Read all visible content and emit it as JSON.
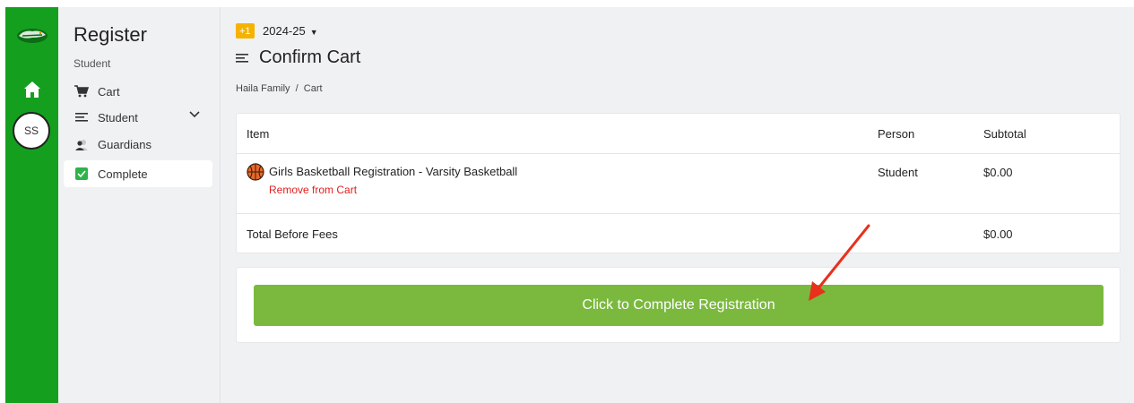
{
  "rail": {
    "logo_icon": "gator-logo-icon",
    "home_icon": "home-icon",
    "avatar_initials": "SS",
    "accent": "#14a01e"
  },
  "sidebar": {
    "title": "Register",
    "subtitle": "Student",
    "items": [
      {
        "label": "Cart",
        "icon": "cart-icon"
      },
      {
        "label": "Student",
        "icon": "menu-icon",
        "expanded": true
      },
      {
        "label": "Guardians",
        "icon": "guardians-icon"
      },
      {
        "label": "Complete",
        "icon": "checkbox-checked-icon",
        "active": true
      }
    ]
  },
  "header": {
    "year_badge": "+1",
    "year": "2024-25",
    "title": "Confirm Cart",
    "breadcrumb": "Haila Family  /  Cart"
  },
  "cart": {
    "columns": {
      "item": "Item",
      "person": "Person",
      "subtotal": "Subtotal"
    },
    "rows": [
      {
        "icon": "basketball-icon",
        "item": "Girls Basketball Registration - Varsity Basketball",
        "remove_label": "Remove from Cart",
        "person": "Student",
        "subtotal": "$0.00"
      }
    ],
    "total_label": "Total Before Fees",
    "total_value": "$0.00"
  },
  "cta": {
    "label": "Click to Complete Registration",
    "color": "#7ab93d"
  },
  "annotation": {
    "arrow_color": "#e8301c"
  }
}
